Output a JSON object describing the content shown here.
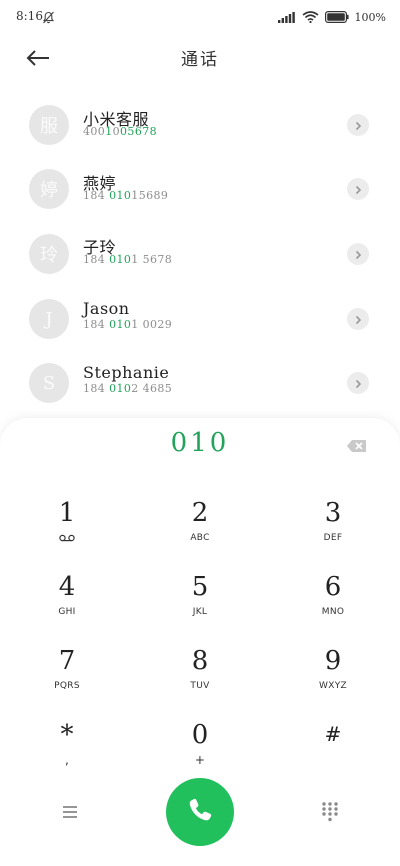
{
  "status_bar": {
    "time": "8:16",
    "battery": "100%"
  },
  "header": {
    "title": "通话"
  },
  "contacts": [
    {
      "avatar": "服",
      "name": "小米客服",
      "number_parts": [
        "400",
        "1",
        "0",
        "05678"
      ]
    },
    {
      "avatar": "婷",
      "name": "燕婷",
      "number_parts": [
        "184 ",
        "010",
        "15689"
      ]
    },
    {
      "avatar": "玲",
      "name": "子玲",
      "number_parts": [
        "184 ",
        "010",
        "1 5678"
      ]
    },
    {
      "avatar": "J",
      "name": "Jason",
      "number_parts": [
        "184 ",
        "010",
        "1 0029"
      ]
    },
    {
      "avatar": "S",
      "name": "Stephanie",
      "number_parts": [
        "184 ",
        "010",
        "2 4685"
      ]
    }
  ],
  "dialer": {
    "entry": "010",
    "keys": [
      {
        "digit": "1",
        "letters": ""
      },
      {
        "digit": "2",
        "letters": "ABC"
      },
      {
        "digit": "3",
        "letters": "DEF"
      },
      {
        "digit": "4",
        "letters": "GHI"
      },
      {
        "digit": "5",
        "letters": "JKL"
      },
      {
        "digit": "6",
        "letters": "MNO"
      },
      {
        "digit": "7",
        "letters": "PQRS"
      },
      {
        "digit": "8",
        "letters": "TUV"
      },
      {
        "digit": "9",
        "letters": "WXYZ"
      },
      {
        "digit": "*",
        "letters": ","
      },
      {
        "digit": "0",
        "letters": "+"
      },
      {
        "digit": "#",
        "letters": ""
      }
    ]
  },
  "colors": {
    "accent": "#22a35a",
    "call_button": "#22c05d"
  },
  "icons": [
    "mute-bell-icon",
    "signal-icon",
    "wifi-icon",
    "battery-icon",
    "back-arrow-icon",
    "chevron-right-icon",
    "backspace-icon",
    "voicemail-icon",
    "menu-icon",
    "phone-icon",
    "keypad-grid-icon"
  ]
}
